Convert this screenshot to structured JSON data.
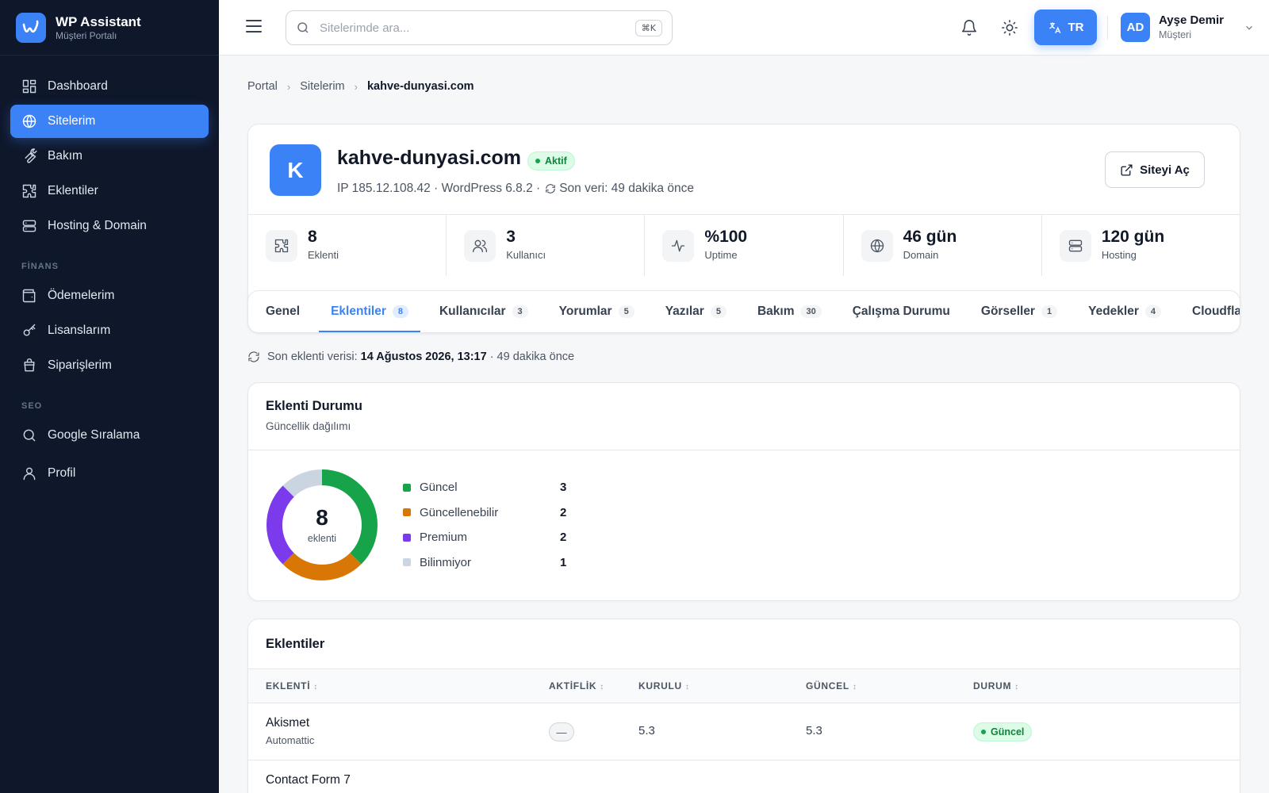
{
  "brand": {
    "title": "WP Assistant",
    "subtitle": "Müşteri Portalı"
  },
  "sidebar": {
    "items": [
      {
        "label": "Dashboard",
        "icon": "dashboard-icon"
      },
      {
        "label": "Sitelerim",
        "icon": "globe-icon",
        "active": true
      },
      {
        "label": "Bakım",
        "icon": "wrench-icon"
      },
      {
        "label": "Eklentiler",
        "icon": "puzzle-icon"
      },
      {
        "label": "Hosting & Domain",
        "icon": "server-icon"
      }
    ],
    "finance_section": "FİNANS",
    "finance_items": [
      {
        "label": "Ödemelerim",
        "icon": "wallet-icon"
      },
      {
        "label": "Lisanslarım",
        "icon": "key-icon"
      },
      {
        "label": "Siparişlerim",
        "icon": "shopping-bag-icon"
      }
    ],
    "seo_section": "SEO",
    "seo_items": [
      {
        "label": "Google Sıralama",
        "icon": "search-icon"
      }
    ],
    "profile_item": {
      "label": "Profil",
      "icon": "user-icon"
    }
  },
  "topbar": {
    "search_placeholder": "Sitelerimde ara...",
    "search_shortcut": "⌘K",
    "language": "TR",
    "user": {
      "initials": "AD",
      "name": "Ayşe Demir",
      "role": "Müşteri"
    }
  },
  "breadcrumb": [
    "Portal",
    "Sitelerim",
    "kahve-dunyasi.com"
  ],
  "site": {
    "initial": "K",
    "name": "kahve-dunyasi.com",
    "status": "Aktif",
    "meta_left": "IP 185.12.108.42 · WordPress 6.8.2 ·",
    "meta_right": "Son veri: 49 dakika önce",
    "open_button": "Siteyi Aç",
    "stats": [
      {
        "value": "8",
        "label": "Eklenti",
        "icon": "puzzle-icon"
      },
      {
        "value": "3",
        "label": "Kullanıcı",
        "icon": "users-icon"
      },
      {
        "value": "%100",
        "label": "Uptime",
        "icon": "activity-icon"
      },
      {
        "value": "46 gün",
        "label": "Domain",
        "icon": "globe-icon"
      },
      {
        "value": "120 gün",
        "label": "Hosting",
        "icon": "server-icon"
      }
    ]
  },
  "tabs": [
    {
      "label": "Genel",
      "count": ""
    },
    {
      "label": "Eklentiler",
      "count": "8",
      "active": true
    },
    {
      "label": "Kullanıcılar",
      "count": "3"
    },
    {
      "label": "Yorumlar",
      "count": "5"
    },
    {
      "label": "Yazılar",
      "count": "5"
    },
    {
      "label": "Bakım",
      "count": "30"
    },
    {
      "label": "Çalışma Durumu",
      "count": ""
    },
    {
      "label": "Görseller",
      "count": "1"
    },
    {
      "label": "Yedekler",
      "count": "4"
    },
    {
      "label": "Cloudflare",
      "count": ""
    }
  ],
  "last_data": {
    "prefix": "Son eklenti verisi:",
    "date": "14 Ağustos 2026, 13:17",
    "suffix": "· 49 dakika önce"
  },
  "plugin_status": {
    "title": "Eklenti Durumu",
    "subtitle": "Güncellik dağılımı",
    "total": "8",
    "total_label": "eklenti",
    "legend": [
      {
        "label": "Güncel",
        "count": 3,
        "color": "#16a34a"
      },
      {
        "label": "Güncellenebilir",
        "count": 2,
        "color": "#d97706"
      },
      {
        "label": "Premium",
        "count": 2,
        "color": "#7c3aed"
      },
      {
        "label": "Bilinmiyor",
        "count": 1,
        "color": "#cbd5e1"
      }
    ]
  },
  "plugins_table": {
    "title": "Eklentiler",
    "columns": [
      "EKLENTİ",
      "AKTİFLİK",
      "KURULU",
      "GÜNCEL",
      "DURUM"
    ],
    "rows": [
      {
        "name": "Akismet",
        "author": "Automattic",
        "active": "—",
        "installed": "5.3",
        "latest": "5.3",
        "status": "Güncel"
      },
      {
        "name": "Contact Form 7",
        "author": "",
        "active": "",
        "installed": "",
        "latest": "",
        "status": ""
      }
    ]
  }
}
